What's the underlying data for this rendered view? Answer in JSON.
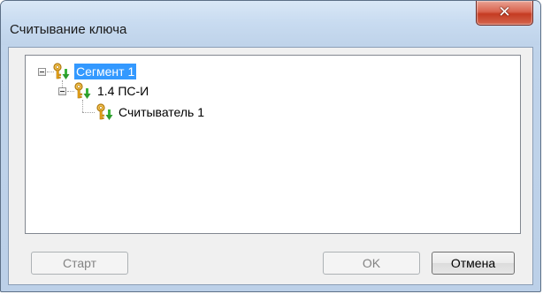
{
  "window": {
    "title": "Считывание ключа",
    "close_glyph": "✕"
  },
  "tree": {
    "nodes": [
      {
        "label": "Сегмент 1",
        "level": 0,
        "expanded": true,
        "selected": true,
        "icon": "key-with-green-arrow-icon"
      },
      {
        "label": "1.4 ПС-И",
        "level": 1,
        "expanded": true,
        "selected": false,
        "icon": "key-with-green-arrow-icon"
      },
      {
        "label": "Считыватель 1",
        "level": 2,
        "expanded": false,
        "selected": false,
        "icon": "key-with-green-arrow-icon"
      }
    ]
  },
  "buttons": {
    "start_label": "Старт",
    "ok_label": "OK",
    "cancel_label": "Отмена"
  },
  "colors": {
    "selection": "#3399ff",
    "close_button": "#c53b22",
    "key_icon": "#e8a317",
    "arrow_icon": "#2e9d2e"
  }
}
